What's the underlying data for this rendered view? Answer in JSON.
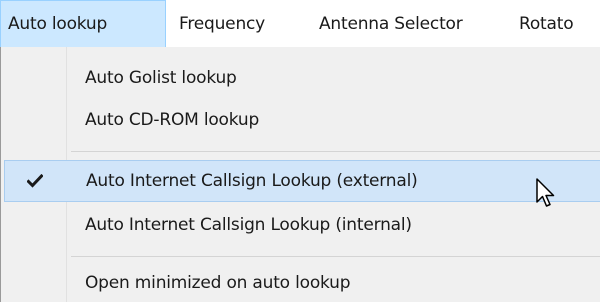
{
  "menubar": {
    "items": [
      {
        "label": "Auto lookup"
      },
      {
        "label": "Frequency"
      },
      {
        "label": "Antenna Selector"
      },
      {
        "label": "Rotato"
      }
    ]
  },
  "dropdown": {
    "items": [
      {
        "label": "Auto Golist lookup"
      },
      {
        "label": "Auto CD-ROM lookup"
      },
      {
        "label": "Auto Internet Callsign Lookup (external)"
      },
      {
        "label": "Auto Internet Callsign Lookup (internal)"
      },
      {
        "label": "Open minimized on auto lookup"
      }
    ]
  },
  "colors": {
    "active_menu_bg": "#cce8ff",
    "highlight_bg": "#d1e5f9",
    "dropdown_bg": "#f0f0f0"
  }
}
